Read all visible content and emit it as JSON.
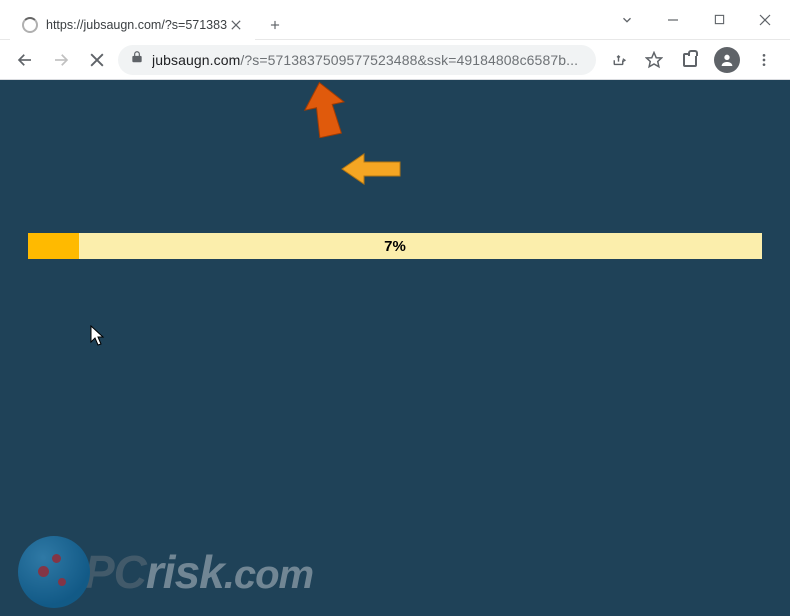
{
  "window": {
    "tab_title": "https://jubsaugn.com/?s=571383",
    "url_domain": "jubsaugn.com",
    "url_query": "/?s=5713837509577523488&ssk=49184808c6587b..."
  },
  "page": {
    "progress_percent": 7,
    "progress_label": "7%",
    "background_color": "#1f4258",
    "bar_track_color": "#fbeeac",
    "bar_fill_color": "#ffba00"
  },
  "overlay": {
    "arrow_up_color": "#e05a0c",
    "arrow_left_color": "#f5a623"
  },
  "watermark": {
    "text_pc": "PC",
    "text_risk": "risk",
    "text_com": ".com"
  }
}
